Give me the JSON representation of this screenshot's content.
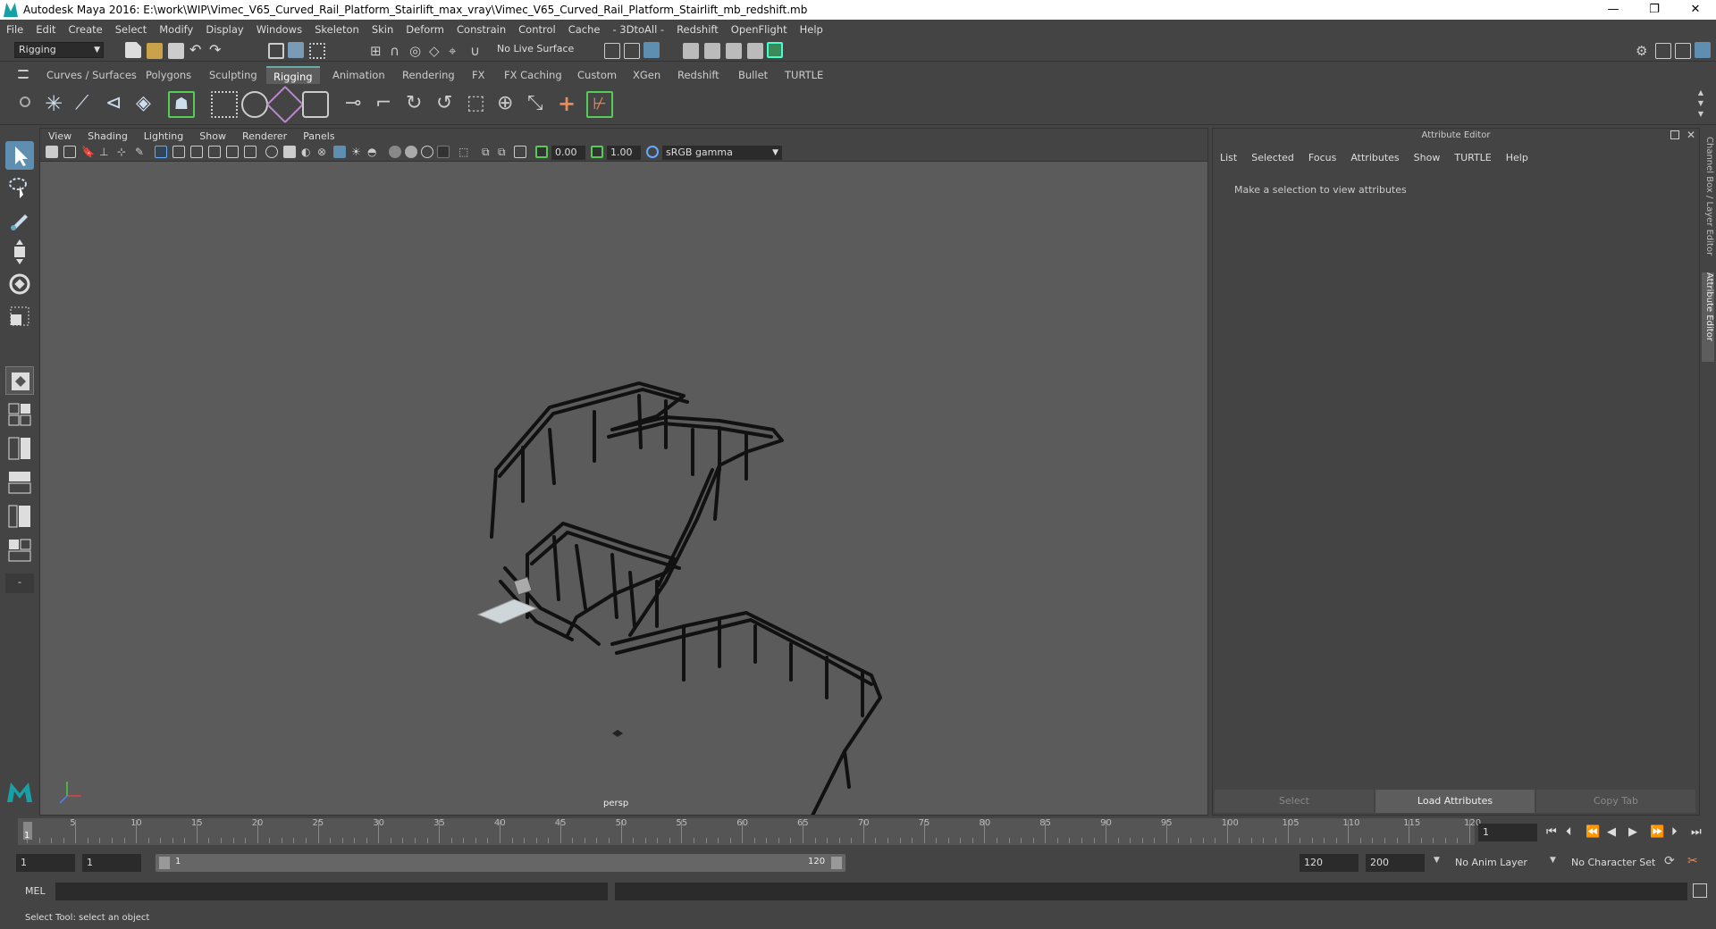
{
  "window": {
    "title": "Autodesk Maya 2016: E:\\work\\WIP\\Vimec_V65_Curved_Rail_Platform_Stairlift_max_vray\\Vimec_V65_Curved_Rail_Platform_Stairlift_mb_redshift.mb",
    "controls": [
      "—",
      "❐",
      "✕"
    ]
  },
  "menubar": [
    "File",
    "Edit",
    "Create",
    "Select",
    "Modify",
    "Display",
    "Windows",
    "Skeleton",
    "Skin",
    "Deform",
    "Constrain",
    "Control",
    "Cache",
    "- 3DtoAll -",
    "Redshift",
    "OpenFlight",
    "Help"
  ],
  "status_line": {
    "menu_set": "Rigging",
    "live_surface": "No Live Surface"
  },
  "shelf_tabs": [
    "Curves / Surfaces",
    "Polygons",
    "Sculpting",
    "Rigging",
    "Animation",
    "Rendering",
    "FX",
    "FX Caching",
    "Custom",
    "XGen",
    "Redshift",
    "Bullet",
    "TURTLE"
  ],
  "active_shelf_tab": "Rigging",
  "viewport": {
    "menu": [
      "View",
      "Shading",
      "Lighting",
      "Show",
      "Renderer",
      "Panels"
    ],
    "exposure": "0.00",
    "gamma": "1.00",
    "color_space": "sRGB gamma",
    "camera_label": "persp"
  },
  "attribute_editor": {
    "title": "Attribute Editor",
    "menu": [
      "List",
      "Selected",
      "Focus",
      "Attributes",
      "Show",
      "TURTLE",
      "Help"
    ],
    "message": "Make a selection to view attributes",
    "buttons": [
      "Select",
      "Load Attributes",
      "Copy Tab"
    ]
  },
  "side_tabs": [
    "Channel Box / Layer Editor",
    "Attribute Editor"
  ],
  "timeline": {
    "ticks": [
      5,
      10,
      15,
      20,
      25,
      30,
      35,
      40,
      45,
      50,
      55,
      60,
      65,
      70,
      75,
      80,
      85,
      90,
      95,
      100,
      105,
      110,
      115,
      120
    ],
    "current_frame_marker": "1",
    "current_frame": "1"
  },
  "range": {
    "start": "1",
    "playback_start": "1",
    "slider_start": "1",
    "slider_end": "120",
    "playback_end": "120",
    "end": "200",
    "anim_layer": "No Anim Layer",
    "character_set": "No Character Set"
  },
  "command_line": {
    "label": "MEL"
  },
  "help_line": "Select Tool: select an object",
  "colors": {
    "ui_bg": "#444444",
    "viewport_bg": "#5b5b5b",
    "accent": "#17a0a5",
    "shelf_active": "#5d5d5d"
  }
}
